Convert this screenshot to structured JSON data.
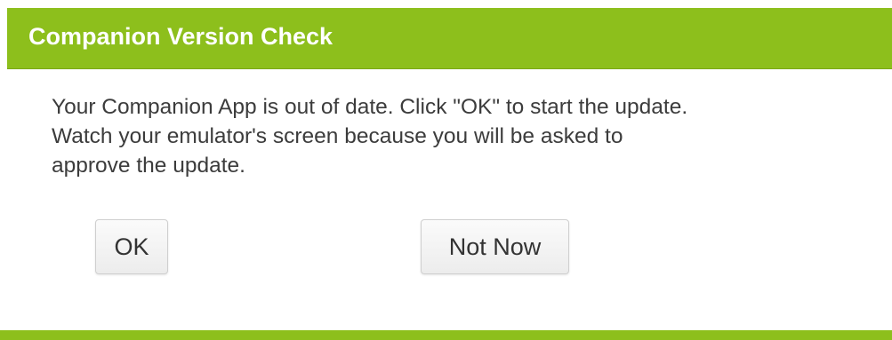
{
  "dialog": {
    "title": "Companion Version Check",
    "message_lines": [
      "Your Companion App is out of date. Click \"OK\" to start the update.",
      "Watch your emulator's screen because you will be asked to",
      "approve the update."
    ],
    "buttons": {
      "ok_label": "OK",
      "not_now_label": "Not Now"
    }
  },
  "colors": {
    "header_bg": "#8dbf1c",
    "header_text": "#ffffff",
    "body_text": "#3c3c3c",
    "button_bg": "#f3f3f3"
  }
}
